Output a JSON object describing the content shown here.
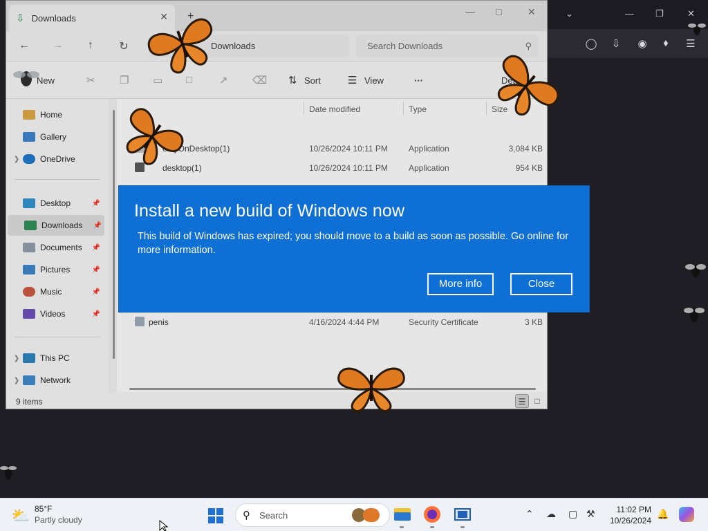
{
  "explorer": {
    "tab_title": "Downloads",
    "address": "Downloads",
    "search_placeholder": "Search Downloads",
    "cmd": {
      "new": "New",
      "sort": "Sort",
      "view": "View",
      "more": "···",
      "details": "Details"
    },
    "sidebar": [
      {
        "label": "Home",
        "icon": "home-icon"
      },
      {
        "label": "Gallery",
        "icon": "gallery-icon"
      },
      {
        "label": "OneDrive",
        "icon": "onedrive-icon"
      },
      {
        "label": "Desktop",
        "icon": "desktop-icon"
      },
      {
        "label": "Downloads",
        "icon": "download-icon"
      },
      {
        "label": "Documents",
        "icon": "documents-icon"
      },
      {
        "label": "Pictures",
        "icon": "pictures-icon"
      },
      {
        "label": "Music",
        "icon": "music-icon"
      },
      {
        "label": "Videos",
        "icon": "videos-icon"
      },
      {
        "label": "This PC",
        "icon": "pc-icon"
      },
      {
        "label": "Network",
        "icon": "network-icon"
      }
    ],
    "columns": {
      "date": "Date modified",
      "type": "Type",
      "size": "Size"
    },
    "files": [
      {
        "name": "erflyOnDesktop(1)",
        "date": "10/26/2024 10:11 PM",
        "type": "Application",
        "size": "3,084 KB"
      },
      {
        "name": "desktop(1)",
        "date": "10/26/2024 10:11 PM",
        "type": "Application",
        "size": "954 KB"
      },
      {
        "name": "penis",
        "date": "4/16/2024 4:44 PM",
        "type": "Security Certificate",
        "size": "3 KB"
      }
    ],
    "status_count": "9 items"
  },
  "dialog": {
    "title": "Install a new build of Windows now",
    "message": "This build of Windows has expired; you should move to a build as soon as possible. Go online for more information.",
    "more_info": "More info",
    "close": "Close"
  },
  "taskbar": {
    "temp": "85°F",
    "condition": "Partly cloudy",
    "search": "Search",
    "time": "11:02 PM",
    "date": "10/26/2024"
  },
  "colors": {
    "dialog_bg": "#0e70d5",
    "accent": "#1f6fd6"
  }
}
